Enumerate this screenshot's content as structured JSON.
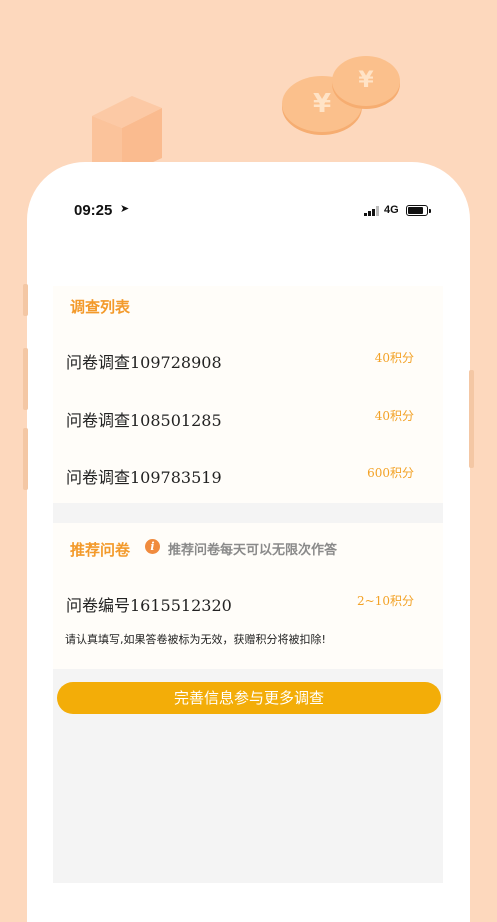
{
  "status": {
    "time": "09:25",
    "network": "4G"
  },
  "survey_list": {
    "title": "调查列表",
    "items": [
      {
        "name": "问卷调查109728908",
        "points": "40积分"
      },
      {
        "name": "问卷调查108501285",
        "points": "40积分"
      },
      {
        "name": "问卷调查109783519",
        "points": "600积分"
      }
    ]
  },
  "recommended": {
    "title": "推荐问卷",
    "tip": "推荐问卷每天可以无限次作答",
    "item": {
      "name": "问卷编号1615512320",
      "points": "2~10积分"
    },
    "warning": "请认真填写,如果答卷被标为无效，获赠积分将被扣除!"
  },
  "cta_label": "完善信息参与更多调查",
  "colors": {
    "accent": "#f39a2b",
    "button": "#f3ad08",
    "background": "#fdd8bd"
  }
}
